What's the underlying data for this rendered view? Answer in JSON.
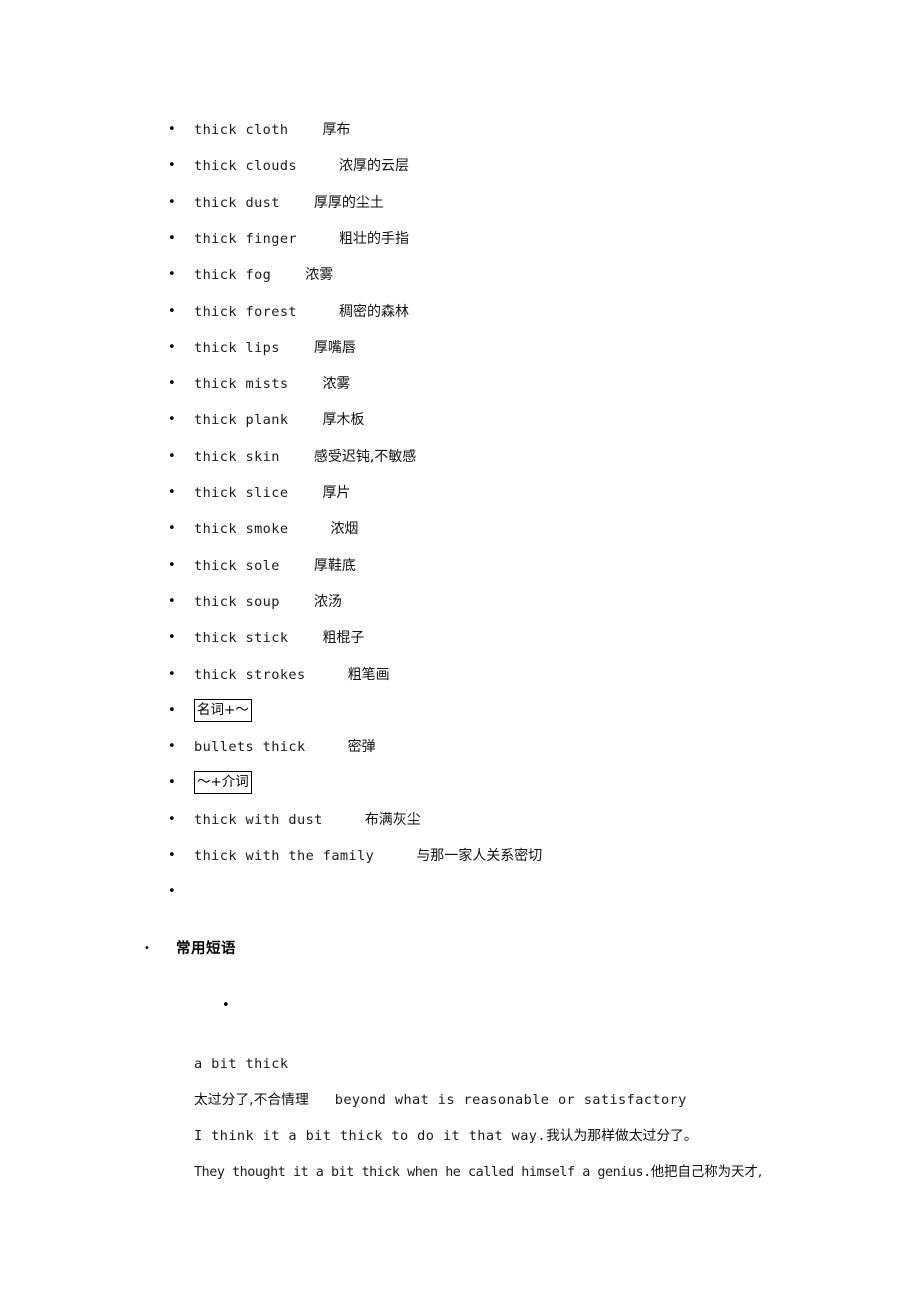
{
  "document": {
    "vocabulary_list": [
      {
        "english": "thick cloth",
        "gap": "gap-md",
        "chinese": "厚布"
      },
      {
        "english": "thick clouds",
        "gap": "gap-lg",
        "chinese": "浓厚的云层"
      },
      {
        "english": "thick dust",
        "gap": "gap-md",
        "chinese": "厚厚的尘土"
      },
      {
        "english": "thick finger",
        "gap": "gap-lg",
        "chinese": "粗壮的手指"
      },
      {
        "english": "thick fog",
        "gap": "gap-md",
        "chinese": "浓雾"
      },
      {
        "english": "thick forest",
        "gap": "gap-lg",
        "chinese": "稠密的森林"
      },
      {
        "english": "thick lips",
        "gap": "gap-md",
        "chinese": "厚嘴唇"
      },
      {
        "english": "thick mists",
        "gap": "gap-md",
        "chinese": "浓雾"
      },
      {
        "english": "thick plank",
        "gap": "gap-md",
        "chinese": "厚木板"
      },
      {
        "english": "thick skin",
        "gap": "gap-md",
        "chinese": "感受迟钝,不敏感"
      },
      {
        "english": "thick slice",
        "gap": "gap-md",
        "chinese": "厚片"
      },
      {
        "english": "thick smoke",
        "gap": "gap-lg",
        "chinese": "浓烟"
      },
      {
        "english": "thick sole",
        "gap": "gap-md",
        "chinese": "厚鞋底"
      },
      {
        "english": "thick soup",
        "gap": "gap-md",
        "chinese": "浓汤"
      },
      {
        "english": "thick stick",
        "gap": "gap-md",
        "chinese": "粗棍子"
      },
      {
        "english": "thick strokes",
        "gap": "gap-lg",
        "chinese": "粗笔画"
      }
    ],
    "boxed_label_noun": "名词+～",
    "noun_example": {
      "english": "bullets thick",
      "gap": "gap-lg",
      "chinese": "密弹"
    },
    "boxed_label_prep": "～+介词",
    "prep_examples": [
      {
        "english": "thick with dust",
        "gap": "gap-lg",
        "chinese": "布满灰尘"
      },
      {
        "english": "thick with the family",
        "gap": "gap-lg",
        "chinese": "与那一家人关系密切"
      }
    ],
    "section_heading": "常用短语",
    "phrase_block": {
      "headword": "a bit thick",
      "definition_chinese": "太过分了,不合情理",
      "definition_english": "beyond what is reasonable or satisfactory",
      "example1_english": "I think it a bit thick to do it that way.",
      "example1_chinese": "我认为那样做太过分了。",
      "example2_english": "They thought it a bit thick when he called himself a genius.",
      "example2_chinese": "他把自己称为天才,"
    }
  }
}
